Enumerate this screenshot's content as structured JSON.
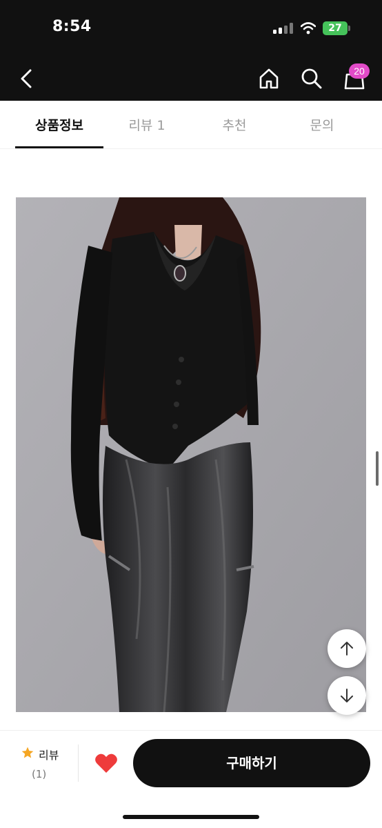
{
  "status_bar": {
    "time": "8:54",
    "battery_level": "27",
    "icons": [
      "cellular-signal-icon",
      "wifi-icon",
      "battery-icon"
    ]
  },
  "nav_bar": {
    "icons": [
      "back-chevron-icon",
      "home-icon",
      "search-icon",
      "shopping-bag-icon"
    ],
    "cart_count": "20",
    "badge_color": "#e24bc8"
  },
  "tabs": [
    {
      "label": "상품정보",
      "active": true
    },
    {
      "label": "리뷰 1",
      "active": false
    },
    {
      "label": "추천",
      "active": false
    },
    {
      "label": "문의",
      "active": false
    }
  ],
  "product_image": {
    "subject": "model in black cowl-neck button-front top and black crinkled nylon cargo maxi skirt",
    "background_color": "#a9a8ad"
  },
  "floating_buttons": {
    "icons": [
      "arrow-up-icon",
      "arrow-down-icon"
    ]
  },
  "bottom_bar": {
    "review_label": "리뷰",
    "review_count": "(1)",
    "buy_label": "구매하기",
    "star_color": "#f5a623",
    "heart_color": "#ee3b3b",
    "button_color": "#111111"
  }
}
